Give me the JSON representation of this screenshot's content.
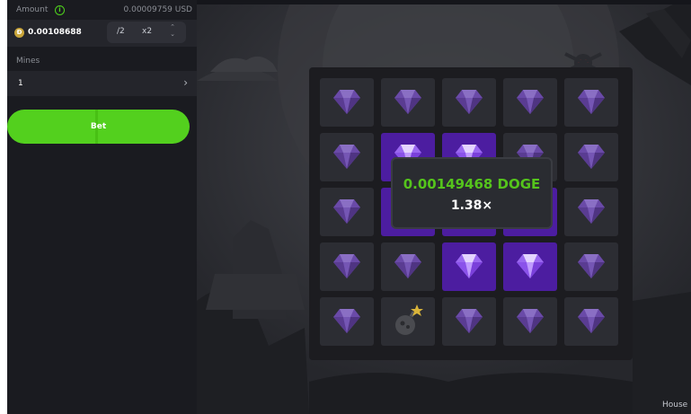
{
  "bet_panel": {
    "amount_label": "Amount",
    "info_icon": "info-icon",
    "amount_usd": "0.00009759 USD",
    "coin_icon": "doge-coin-icon",
    "coin_symbol": "Ð",
    "amount_value": "0.00108688",
    "half_label": "/2",
    "double_label": "x2",
    "mines_label": "Mines",
    "mines_value": "1",
    "bet_label": "Bet"
  },
  "game": {
    "grid": [
      [
        "gem",
        "gem",
        "gem",
        "gem",
        "gem"
      ],
      [
        "gem",
        "gem-picked",
        "gem-picked",
        "gem",
        "gem"
      ],
      [
        "gem",
        "gem-picked",
        "gem-picked",
        "gem-picked",
        "gem"
      ],
      [
        "gem",
        "gem",
        "gem-picked",
        "gem-picked",
        "gem"
      ],
      [
        "gem",
        "bomb",
        "gem",
        "gem",
        "gem"
      ]
    ],
    "payout_amount": "0.00149468 DOGE",
    "payout_multiplier": "1.38×",
    "house_edge_label": "House E"
  },
  "colors": {
    "accent_green": "#53d01e",
    "picked_tile": "#4c1da0",
    "gem": "#8a55e6"
  }
}
